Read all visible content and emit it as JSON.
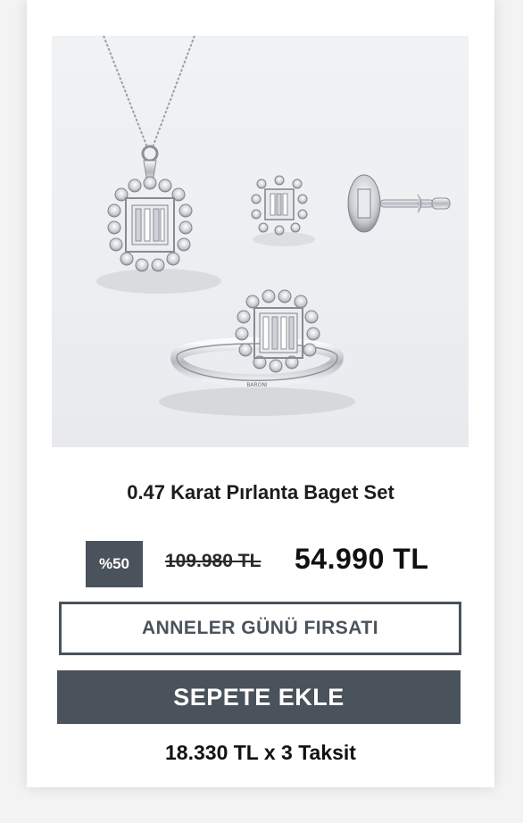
{
  "product": {
    "title": "0.47 Karat Pırlanta Baget Set",
    "discount_badge": "%50",
    "old_price": "109.980 TL",
    "new_price": "54.990 TL",
    "campaign_label": "ANNELER GÜNÜ FIRSATI",
    "add_to_cart_label": "SEPETE EKLE",
    "installment_text": "18.330 TL x 3 Taksit"
  },
  "colors": {
    "accent": "#4a525b",
    "background": "#ffffff"
  }
}
